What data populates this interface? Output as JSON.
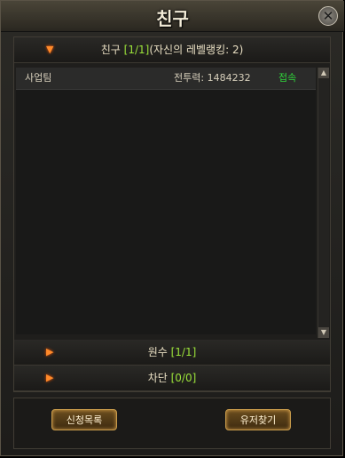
{
  "window": {
    "title": "친구",
    "close_icon": "close-icon"
  },
  "sections": [
    {
      "label": "친구",
      "count": "[1/1]",
      "suffix": "(자신의 레벨랭킹: 2)",
      "expanded": true
    },
    {
      "label": "원수",
      "count": "[1/1]",
      "expanded": false
    },
    {
      "label": "차단",
      "count": "[0/0]",
      "expanded": false
    }
  ],
  "friends": [
    {
      "name": "사업팀",
      "power_label": "전투력:",
      "power_value": "1484232",
      "status": "접속"
    }
  ],
  "buttons": {
    "requests": "신청목록",
    "find_user": "유저찾기"
  },
  "colors": {
    "accent_orange": "#ff8a2a",
    "count_green": "#9be23a",
    "online_green": "#2fd33a"
  }
}
